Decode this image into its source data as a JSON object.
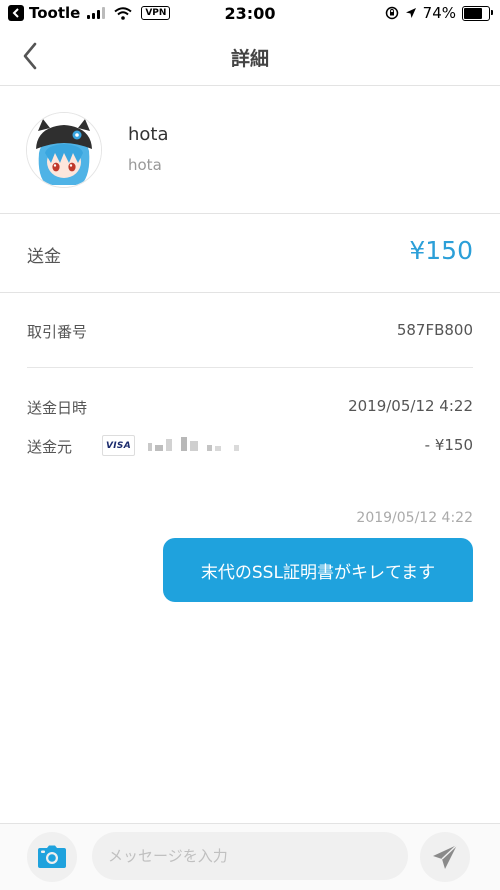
{
  "status_bar": {
    "carrier": "Tootle",
    "vpn": "VPN",
    "time": "23:00",
    "battery": "74%",
    "battery_level": 0.74
  },
  "nav": {
    "title": "詳細"
  },
  "profile": {
    "name": "hota",
    "id": "hota"
  },
  "transfer": {
    "label": "送金",
    "amount": "¥150"
  },
  "details": {
    "transaction_no_label": "取引番号",
    "transaction_no": "587FB800",
    "datetime_label": "送金日時",
    "datetime": "2019/05/12 4:22",
    "source_label": "送金元",
    "card_brand": "VISA",
    "source_amount": "- ¥150"
  },
  "message": {
    "time": "2019/05/12 4:22",
    "text": "末代のSSL証明書がキレてます"
  },
  "composer": {
    "placeholder": "メッセージを入力"
  },
  "colors": {
    "accent": "#2b9fd8",
    "bubble": "#1fa2dd"
  },
  "icons": [
    "back-app-icon",
    "signal-icon",
    "wifi-icon",
    "orientation-lock-icon",
    "location-icon",
    "battery-icon",
    "chevron-left-icon",
    "avatar",
    "camera-icon",
    "send-icon"
  ]
}
